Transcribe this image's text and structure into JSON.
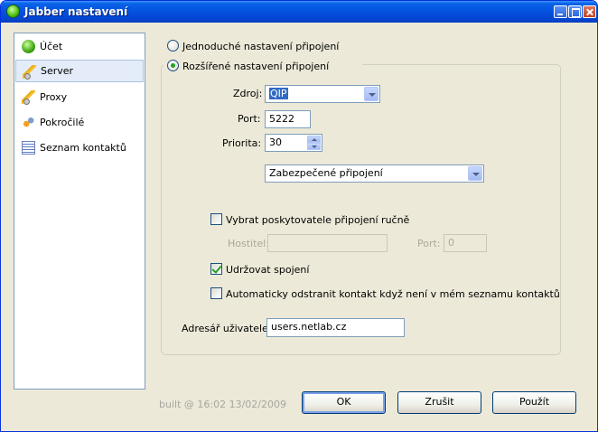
{
  "window": {
    "title": "Jabber nastavení"
  },
  "sidebar": {
    "items": [
      {
        "label": "Účet",
        "icon": "account-icon"
      },
      {
        "label": "Server",
        "icon": "plug-icon",
        "selected": true
      },
      {
        "label": "Proxy",
        "icon": "plug-icon"
      },
      {
        "label": "Pokročilé",
        "icon": "gears-icon"
      },
      {
        "label": "Seznam kontaktů",
        "icon": "list-icon"
      }
    ]
  },
  "connection": {
    "simple_label": "Jednoduché nastavení připojení",
    "advanced_label": "Rozšířené nastavení připojení",
    "selected": "advanced"
  },
  "server": {
    "source_label": "Zdroj:",
    "source_value": "QIP",
    "port_label": "Port:",
    "port_value": "5222",
    "priority_label": "Priorita:",
    "priority_value": "30",
    "security_value": "Zabezpečené připojení",
    "manual_provider_label": "Vybrat poskytovatele připojení ručně",
    "manual_provider_checked": false,
    "host_label": "Hostitel:",
    "host_value": "",
    "host_port_label": "Port:",
    "host_port_value": "0",
    "keepalive_label": "Udržovat spojení",
    "keepalive_checked": true,
    "auto_remove_label": "Automaticky odstranit kontakt když není v mém seznamu kontaktů",
    "auto_remove_checked": false,
    "user_dir_label": "Adresář uživatele:",
    "user_dir_value": "users.netlab.cz"
  },
  "footer": {
    "built": "built @ 16:02 13/02/2009",
    "ok_label": "OK",
    "cancel_label": "Zrušit",
    "apply_label": "Použít"
  }
}
